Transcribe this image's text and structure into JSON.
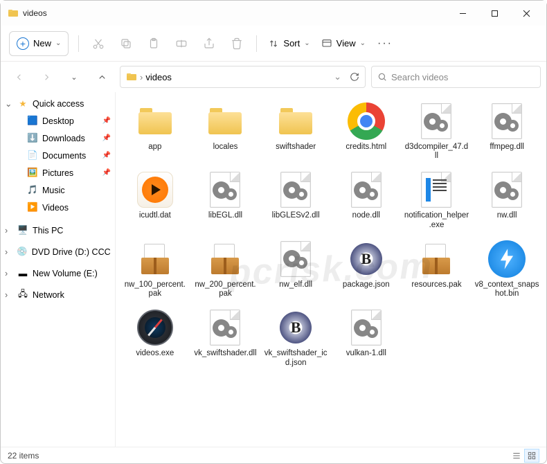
{
  "title": "videos",
  "toolbar": {
    "new": "New",
    "sort": "Sort",
    "view": "View"
  },
  "breadcrumb": {
    "path": "videos"
  },
  "search": {
    "placeholder": "Search videos"
  },
  "sidebar": {
    "quick": "Quick access",
    "items": [
      {
        "label": "Desktop",
        "pin": true
      },
      {
        "label": "Downloads",
        "pin": true
      },
      {
        "label": "Documents",
        "pin": true
      },
      {
        "label": "Pictures",
        "pin": true
      },
      {
        "label": "Music"
      },
      {
        "label": "Videos"
      }
    ],
    "thispc": "This PC",
    "dvd": "DVD Drive (D:) CCCC",
    "newvol": "New Volume (E:)",
    "network": "Network"
  },
  "files": [
    {
      "name": "app",
      "type": "folder"
    },
    {
      "name": "locales",
      "type": "folder"
    },
    {
      "name": "swiftshader",
      "type": "folder"
    },
    {
      "name": "credits.html",
      "type": "chrome"
    },
    {
      "name": "d3dcompiler_47.dll",
      "type": "dll"
    },
    {
      "name": "ffmpeg.dll",
      "type": "dll"
    },
    {
      "name": "icudtl.dat",
      "type": "icu"
    },
    {
      "name": "libEGL.dll",
      "type": "dll"
    },
    {
      "name": "libGLESv2.dll",
      "type": "dll"
    },
    {
      "name": "node.dll",
      "type": "dll"
    },
    {
      "name": "notification_helper.exe",
      "type": "notif"
    },
    {
      "name": "nw.dll",
      "type": "dll"
    },
    {
      "name": "nw_100_percent.pak",
      "type": "pak"
    },
    {
      "name": "nw_200_percent.pak",
      "type": "pak"
    },
    {
      "name": "nw_elf.dll",
      "type": "dll"
    },
    {
      "name": "package.json",
      "type": "json"
    },
    {
      "name": "resources.pak",
      "type": "pak"
    },
    {
      "name": "v8_context_snapshot.bin",
      "type": "v8"
    },
    {
      "name": "videos.exe",
      "type": "compass"
    },
    {
      "name": "vk_swiftshader.dll",
      "type": "dll"
    },
    {
      "name": "vk_swiftshader_icd.json",
      "type": "json"
    },
    {
      "name": "vulkan-1.dll",
      "type": "dll"
    }
  ],
  "status": {
    "count": "22 items"
  },
  "watermark": "pcrisk.com"
}
